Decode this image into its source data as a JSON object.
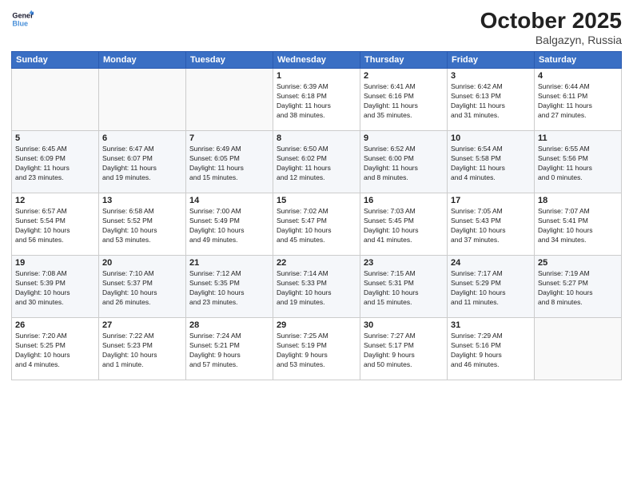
{
  "header": {
    "logo_line1": "General",
    "logo_line2": "Blue",
    "month": "October 2025",
    "location": "Balgazyn, Russia"
  },
  "weekdays": [
    "Sunday",
    "Monday",
    "Tuesday",
    "Wednesday",
    "Thursday",
    "Friday",
    "Saturday"
  ],
  "weeks": [
    [
      {
        "day": "",
        "info": ""
      },
      {
        "day": "",
        "info": ""
      },
      {
        "day": "",
        "info": ""
      },
      {
        "day": "1",
        "info": "Sunrise: 6:39 AM\nSunset: 6:18 PM\nDaylight: 11 hours\nand 38 minutes."
      },
      {
        "day": "2",
        "info": "Sunrise: 6:41 AM\nSunset: 6:16 PM\nDaylight: 11 hours\nand 35 minutes."
      },
      {
        "day": "3",
        "info": "Sunrise: 6:42 AM\nSunset: 6:13 PM\nDaylight: 11 hours\nand 31 minutes."
      },
      {
        "day": "4",
        "info": "Sunrise: 6:44 AM\nSunset: 6:11 PM\nDaylight: 11 hours\nand 27 minutes."
      }
    ],
    [
      {
        "day": "5",
        "info": "Sunrise: 6:45 AM\nSunset: 6:09 PM\nDaylight: 11 hours\nand 23 minutes."
      },
      {
        "day": "6",
        "info": "Sunrise: 6:47 AM\nSunset: 6:07 PM\nDaylight: 11 hours\nand 19 minutes."
      },
      {
        "day": "7",
        "info": "Sunrise: 6:49 AM\nSunset: 6:05 PM\nDaylight: 11 hours\nand 15 minutes."
      },
      {
        "day": "8",
        "info": "Sunrise: 6:50 AM\nSunset: 6:02 PM\nDaylight: 11 hours\nand 12 minutes."
      },
      {
        "day": "9",
        "info": "Sunrise: 6:52 AM\nSunset: 6:00 PM\nDaylight: 11 hours\nand 8 minutes."
      },
      {
        "day": "10",
        "info": "Sunrise: 6:54 AM\nSunset: 5:58 PM\nDaylight: 11 hours\nand 4 minutes."
      },
      {
        "day": "11",
        "info": "Sunrise: 6:55 AM\nSunset: 5:56 PM\nDaylight: 11 hours\nand 0 minutes."
      }
    ],
    [
      {
        "day": "12",
        "info": "Sunrise: 6:57 AM\nSunset: 5:54 PM\nDaylight: 10 hours\nand 56 minutes."
      },
      {
        "day": "13",
        "info": "Sunrise: 6:58 AM\nSunset: 5:52 PM\nDaylight: 10 hours\nand 53 minutes."
      },
      {
        "day": "14",
        "info": "Sunrise: 7:00 AM\nSunset: 5:49 PM\nDaylight: 10 hours\nand 49 minutes."
      },
      {
        "day": "15",
        "info": "Sunrise: 7:02 AM\nSunset: 5:47 PM\nDaylight: 10 hours\nand 45 minutes."
      },
      {
        "day": "16",
        "info": "Sunrise: 7:03 AM\nSunset: 5:45 PM\nDaylight: 10 hours\nand 41 minutes."
      },
      {
        "day": "17",
        "info": "Sunrise: 7:05 AM\nSunset: 5:43 PM\nDaylight: 10 hours\nand 37 minutes."
      },
      {
        "day": "18",
        "info": "Sunrise: 7:07 AM\nSunset: 5:41 PM\nDaylight: 10 hours\nand 34 minutes."
      }
    ],
    [
      {
        "day": "19",
        "info": "Sunrise: 7:08 AM\nSunset: 5:39 PM\nDaylight: 10 hours\nand 30 minutes."
      },
      {
        "day": "20",
        "info": "Sunrise: 7:10 AM\nSunset: 5:37 PM\nDaylight: 10 hours\nand 26 minutes."
      },
      {
        "day": "21",
        "info": "Sunrise: 7:12 AM\nSunset: 5:35 PM\nDaylight: 10 hours\nand 23 minutes."
      },
      {
        "day": "22",
        "info": "Sunrise: 7:14 AM\nSunset: 5:33 PM\nDaylight: 10 hours\nand 19 minutes."
      },
      {
        "day": "23",
        "info": "Sunrise: 7:15 AM\nSunset: 5:31 PM\nDaylight: 10 hours\nand 15 minutes."
      },
      {
        "day": "24",
        "info": "Sunrise: 7:17 AM\nSunset: 5:29 PM\nDaylight: 10 hours\nand 11 minutes."
      },
      {
        "day": "25",
        "info": "Sunrise: 7:19 AM\nSunset: 5:27 PM\nDaylight: 10 hours\nand 8 minutes."
      }
    ],
    [
      {
        "day": "26",
        "info": "Sunrise: 7:20 AM\nSunset: 5:25 PM\nDaylight: 10 hours\nand 4 minutes."
      },
      {
        "day": "27",
        "info": "Sunrise: 7:22 AM\nSunset: 5:23 PM\nDaylight: 10 hours\nand 1 minute."
      },
      {
        "day": "28",
        "info": "Sunrise: 7:24 AM\nSunset: 5:21 PM\nDaylight: 9 hours\nand 57 minutes."
      },
      {
        "day": "29",
        "info": "Sunrise: 7:25 AM\nSunset: 5:19 PM\nDaylight: 9 hours\nand 53 minutes."
      },
      {
        "day": "30",
        "info": "Sunrise: 7:27 AM\nSunset: 5:17 PM\nDaylight: 9 hours\nand 50 minutes."
      },
      {
        "day": "31",
        "info": "Sunrise: 7:29 AM\nSunset: 5:16 PM\nDaylight: 9 hours\nand 46 minutes."
      },
      {
        "day": "",
        "info": ""
      }
    ]
  ]
}
